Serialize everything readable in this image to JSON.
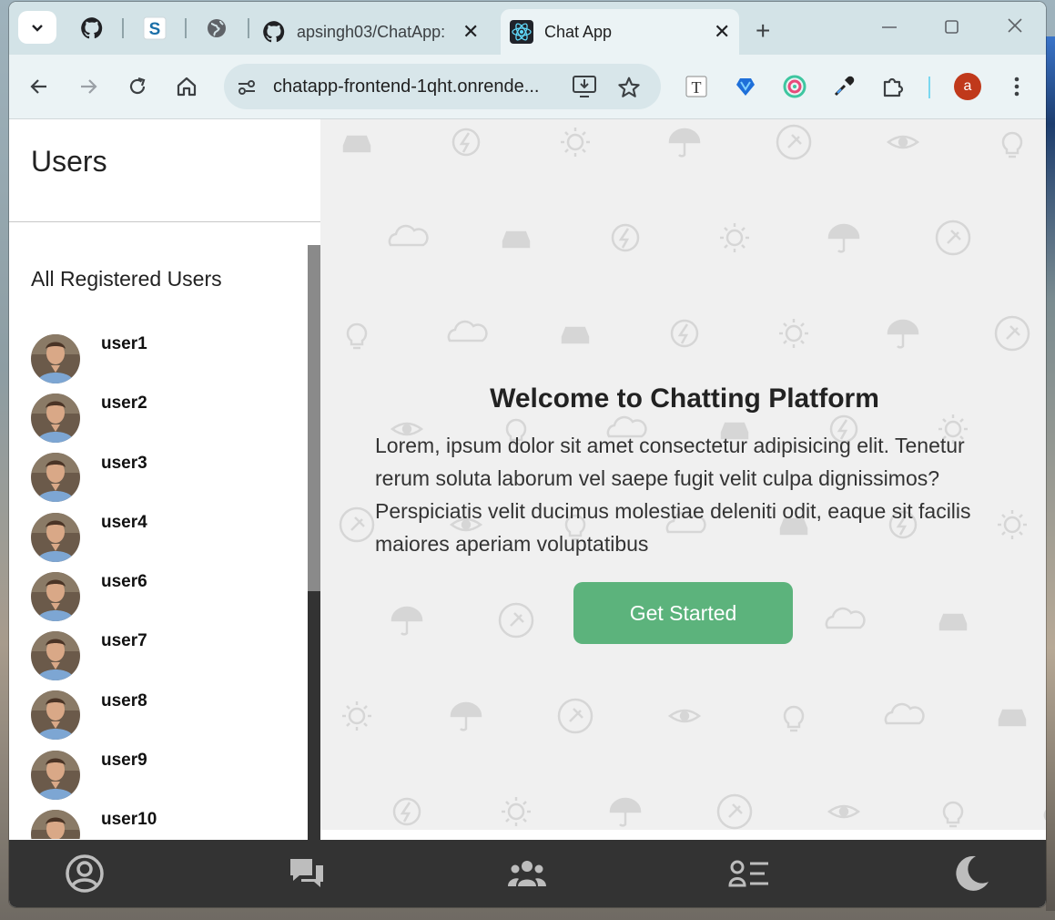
{
  "browser": {
    "tabs": [
      {
        "title": "apsingh03/ChatApp:",
        "close": "✕"
      },
      {
        "title": "Chat App",
        "close": "✕"
      }
    ],
    "new_tab": "+",
    "url": "chatapp-frontend-1qht.onrende...",
    "profile_initial": "a",
    "icons": [
      "tab-search-icon",
      "github-icon",
      "s-icon",
      "globe-icon",
      "react-icon",
      "back-icon",
      "forward-icon",
      "reload-icon",
      "home-icon",
      "site-info-icon",
      "install-icon",
      "star-icon",
      "extension-t-icon",
      "extension-heart-icon",
      "extension-circle-icon",
      "eyedropper-icon",
      "puzzle-icon",
      "menu-icon"
    ]
  },
  "sidebar": {
    "title": "Users",
    "section": "All Registered Users",
    "users": [
      "user1",
      "user2",
      "user3",
      "user4",
      "user6",
      "user7",
      "user8",
      "user9",
      "user10"
    ]
  },
  "main": {
    "heading": "Welcome to Chatting Platform",
    "body": "Lorem, ipsum dolor sit amet consectetur adipisicing elit. Tenetur rerum soluta laborum vel saepe fugit velit culpa dignissimos? Perspiciatis velit ducimus molestiae deleniti odit, eaque sit facilis maiores aperiam voluptatibus",
    "cta": "Get Started"
  },
  "bottom_nav": [
    "profile-icon",
    "chats-icon",
    "groups-icon",
    "contacts-icon",
    "dark-mode-icon"
  ],
  "colors": {
    "accent": "#5cb37c",
    "bottom_bar": "#333333",
    "main_bg": "#f0f0f0",
    "tab_strip": "#d3e3e7"
  }
}
